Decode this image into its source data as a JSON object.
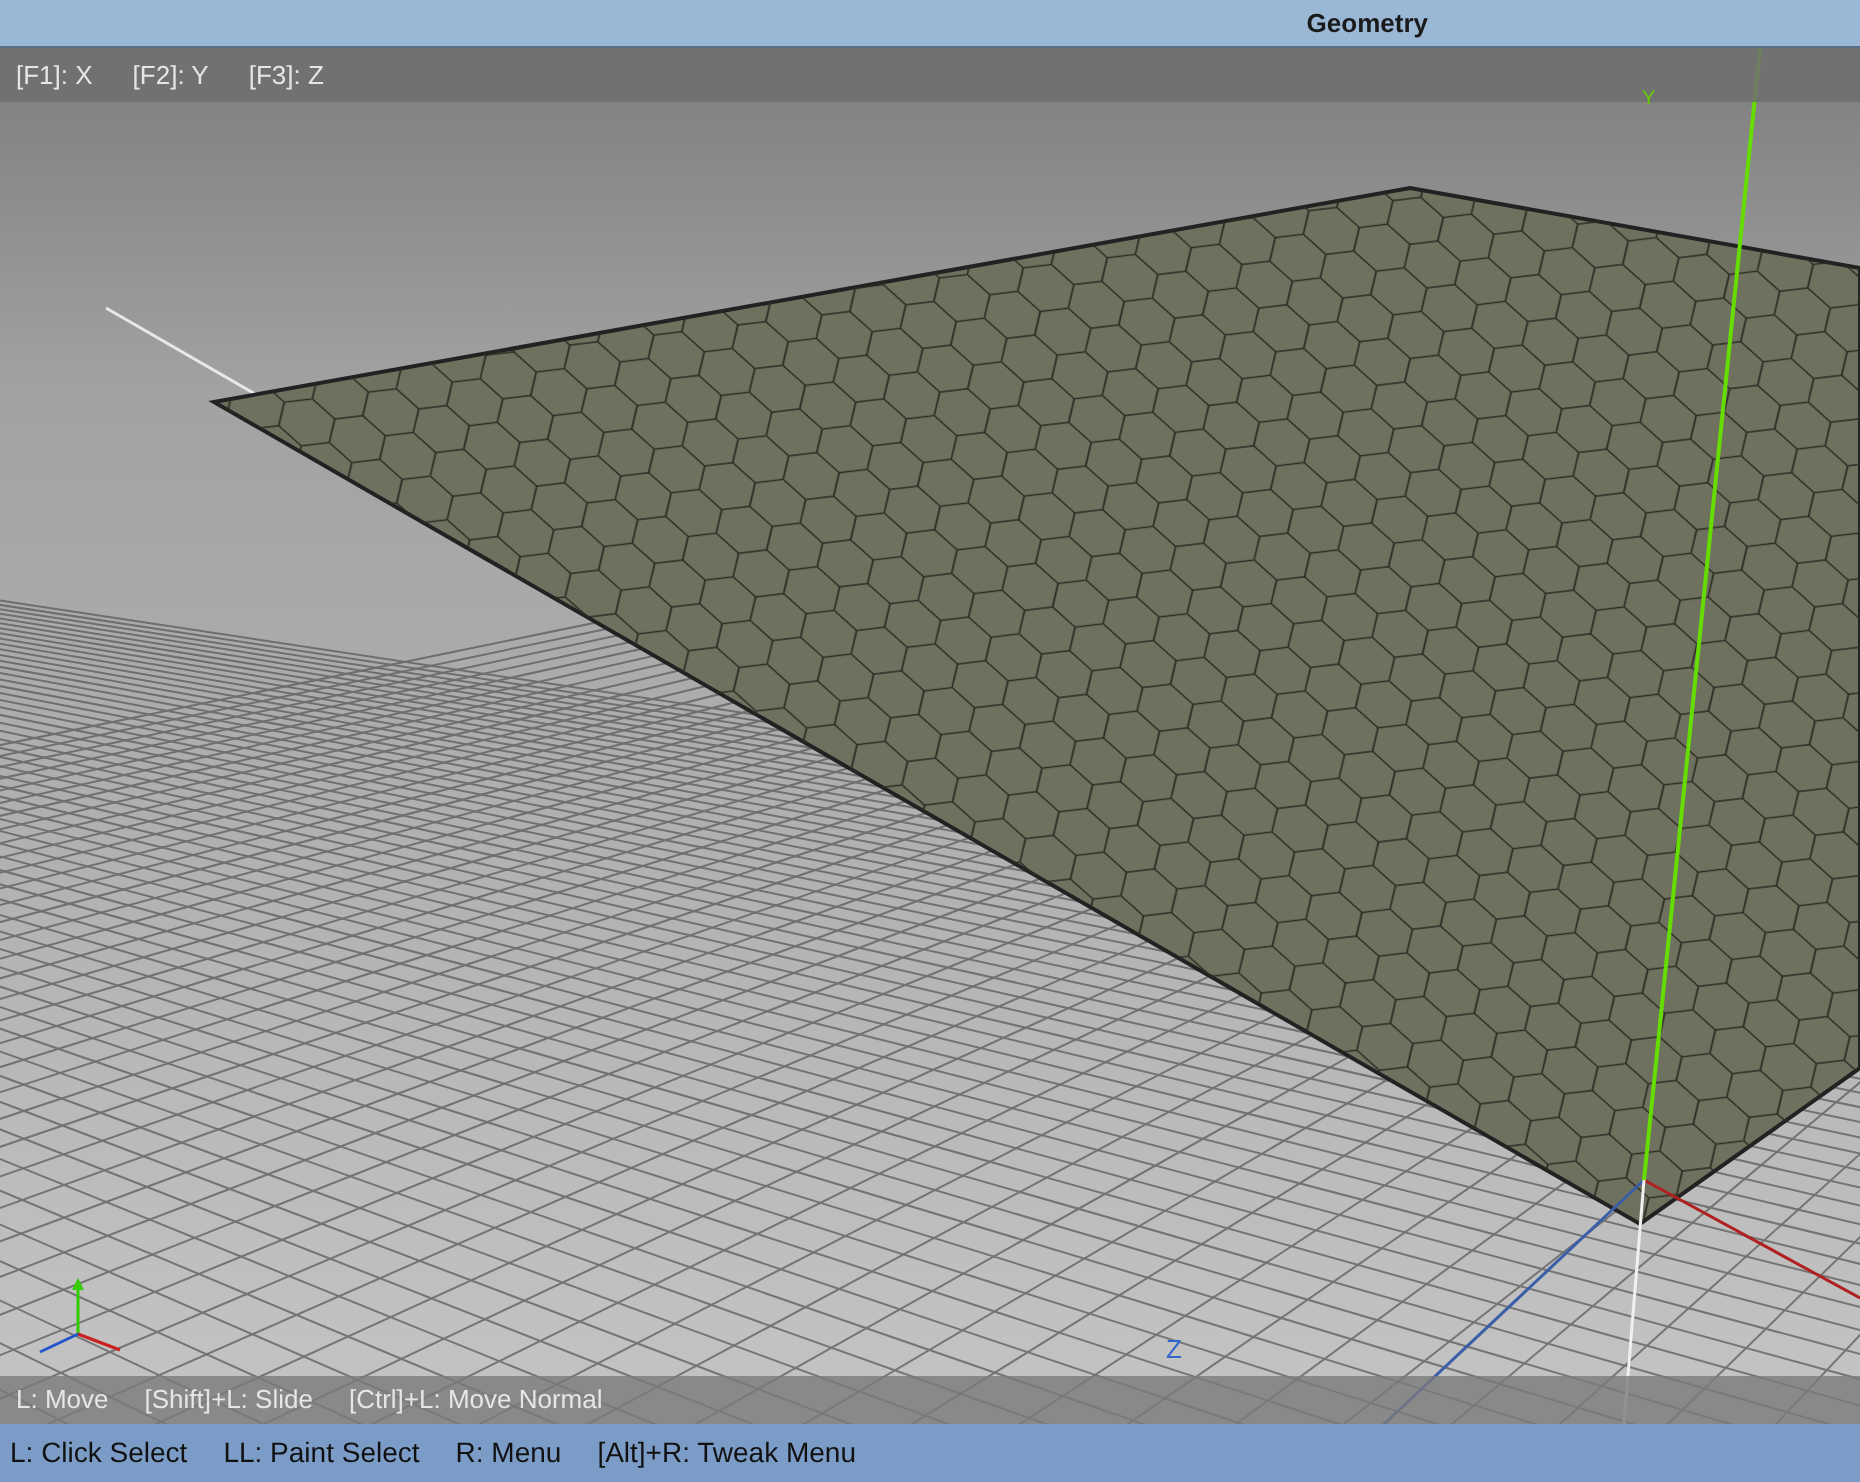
{
  "window": {
    "title": "Geometry"
  },
  "top_hints": [
    "[F1]: X",
    "[F2]: Y",
    "[F3]: Z"
  ],
  "viewport": {
    "axis_labels": [
      {
        "text": "Y",
        "color": "#66cc00"
      },
      {
        "text": "Z",
        "color": "#3366cc"
      }
    ]
  },
  "bottom_hints": [
    "L: Move",
    "[Shift]+L: Slide",
    "[Ctrl]+L: Move Normal"
  ],
  "status_bar": [
    "L: Click Select",
    "LL: Paint Select",
    "R: Menu",
    "[Alt]+R: Tweak Menu"
  ]
}
